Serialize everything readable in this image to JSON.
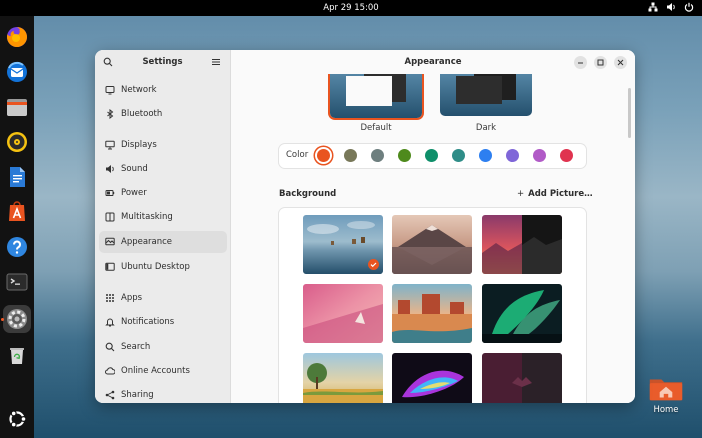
{
  "topbar": {
    "clock": "Apr 29  15:00"
  },
  "dock": {
    "items": [
      {
        "name": "firefox-icon"
      },
      {
        "name": "thunderbird-icon"
      },
      {
        "name": "files-icon"
      },
      {
        "name": "rhythmbox-icon"
      },
      {
        "name": "writer-icon"
      },
      {
        "name": "app-center-icon"
      },
      {
        "name": "help-icon"
      },
      {
        "name": "terminal-icon"
      },
      {
        "name": "settings-icon"
      },
      {
        "name": "trash-icon"
      },
      {
        "name": "show-apps-icon"
      }
    ]
  },
  "desktop": {
    "home_label": "Home"
  },
  "sidebar": {
    "title": "Settings",
    "items": [
      {
        "label": "Network",
        "icon": "network-icon"
      },
      {
        "label": "Bluetooth",
        "icon": "bluetooth-icon"
      },
      {
        "label": "Displays",
        "icon": "display-icon"
      },
      {
        "label": "Sound",
        "icon": "speaker-icon"
      },
      {
        "label": "Power",
        "icon": "power-icon"
      },
      {
        "label": "Multitasking",
        "icon": "multitasking-icon"
      },
      {
        "label": "Appearance",
        "icon": "appearance-icon"
      },
      {
        "label": "Ubuntu Desktop",
        "icon": "ubuntu-desktop-icon"
      },
      {
        "label": "Apps",
        "icon": "apps-grid-icon"
      },
      {
        "label": "Notifications",
        "icon": "bell-icon"
      },
      {
        "label": "Search",
        "icon": "search-icon"
      },
      {
        "label": "Online Accounts",
        "icon": "cloud-icon"
      },
      {
        "label": "Sharing",
        "icon": "share-icon"
      }
    ],
    "selected": "Appearance"
  },
  "header": {
    "title": "Appearance"
  },
  "style": {
    "options": [
      {
        "label": "Default",
        "selected": true
      },
      {
        "label": "Dark",
        "selected": false
      }
    ]
  },
  "accent": {
    "label": "Color",
    "colors": [
      "#e95420",
      "#787859",
      "#6e7f7f",
      "#4e8a1c",
      "#0f8f6a",
      "#2f8d88",
      "#2d7ff0",
      "#7f66d8",
      "#b15bc7",
      "#e0334f"
    ],
    "selected": "#e95420"
  },
  "background": {
    "heading": "Background",
    "add_label": "Add Picture…",
    "selected_index": 0
  }
}
